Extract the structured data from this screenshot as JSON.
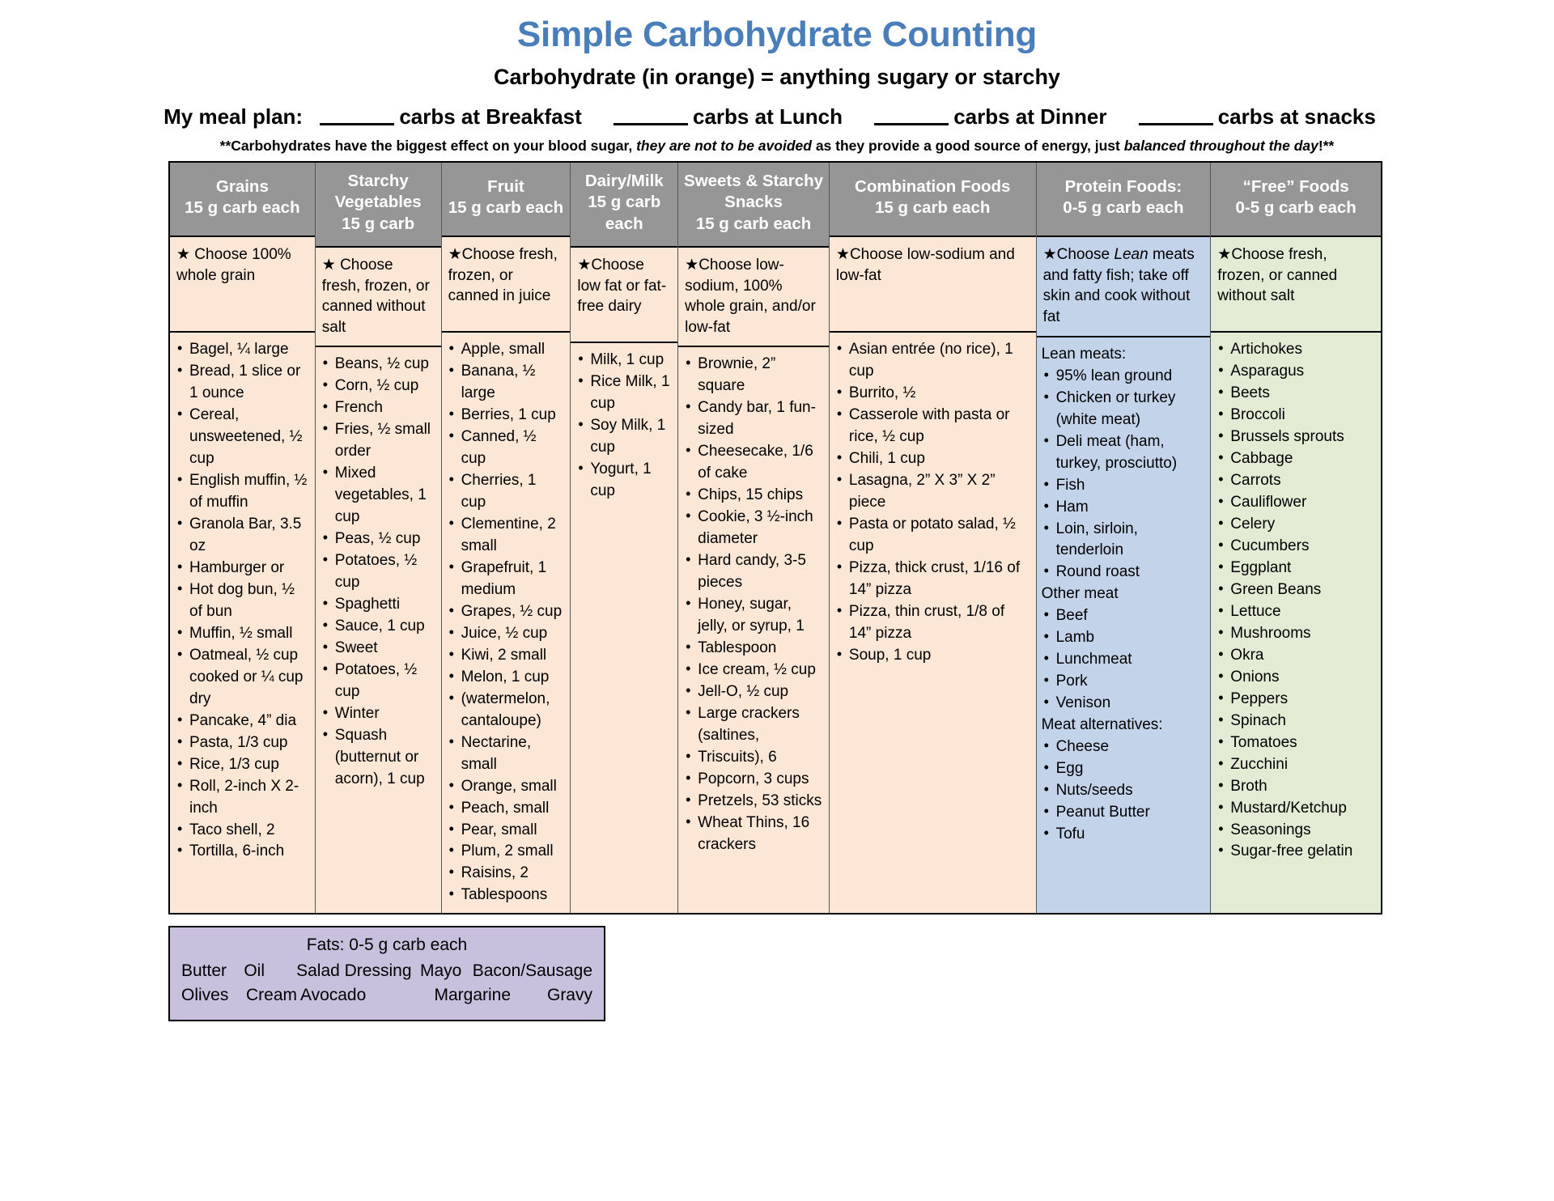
{
  "header": {
    "title": "Simple Carbohydrate Counting",
    "subtitle": "Carbohydrate (in orange) = anything sugary or starchy",
    "title_color": "#4a7ebb",
    "meal_plan": {
      "label": "My meal plan:",
      "seg1": "carbs at Breakfast",
      "seg2": "carbs at Lunch",
      "seg3": "carbs at Dinner",
      "seg4": "carbs at snacks"
    },
    "disclaimer": {
      "part1": "**Carbohydrates have the biggest effect on your blood sugar,",
      "em1": "they are not to be avoided",
      "part2": "as they provide a good source of energy, just",
      "em2": "balanced throughout the day",
      "part3": "!**"
    }
  },
  "colors": {
    "header_bg": "#969696",
    "carb_bg": "#fce6d5",
    "protein_bg": "#c3d4ea",
    "free_bg": "#e2ecd5",
    "fats_bg": "#c9c0dd"
  },
  "columns": [
    {
      "key": "grains",
      "title_line1": "Grains",
      "title_line2": "15 g carb each",
      "choose_pre": "★ Choose 100% whole grain",
      "items": [
        "Bagel, ¼ large",
        "Bread, 1 slice or 1 ounce",
        "Cereal, unsweetened, ½ cup",
        "English muffin, ½ of muffin",
        "Granola Bar, 3.5 oz",
        "Hamburger or",
        "Hot dog bun, ½ of bun",
        "Muffin, ½ small",
        "Oatmeal, ½ cup cooked or ¼ cup dry",
        "Pancake, 4” dia",
        "Pasta, 1/3 cup",
        "Rice, 1/3 cup",
        "Roll, 2-inch X 2-inch",
        "Taco shell, 2",
        "Tortilla, 6-inch"
      ]
    },
    {
      "key": "starchy_vegetables",
      "title_line1": "Starchy Vegetables",
      "title_line2": "15 g carb",
      "choose_pre": "★ Choose fresh, frozen, or canned without salt",
      "items": [
        "Beans, ½ cup",
        "Corn, ½ cup",
        "French",
        "Fries, ½ small order",
        "Mixed vegetables, 1 cup",
        "Peas, ½ cup",
        "Potatoes, ½ cup",
        "Spaghetti",
        "Sauce, 1 cup",
        "Sweet",
        "Potatoes, ½ cup",
        "Winter",
        "Squash (butternut or acorn), 1 cup"
      ]
    },
    {
      "key": "fruit",
      "title_line1": "Fruit",
      "title_line2": "15 g carb each",
      "choose_pre": "★Choose fresh, frozen, or canned in juice",
      "items": [
        "Apple, small",
        "Banana, ½ large",
        "Berries,  1 cup",
        "Canned, ½ cup",
        "Cherries, 1 cup",
        "Clementine, 2 small",
        "Grapefruit, 1 medium",
        "Grapes, ½ cup",
        "Juice, ½ cup",
        "Kiwi, 2 small",
        "Melon, 1 cup",
        "(watermelon, cantaloupe)",
        "Nectarine, small",
        "Orange, small",
        "Peach, small",
        "Pear, small",
        "Plum, 2 small",
        "Raisins, 2",
        "Tablespoons"
      ]
    },
    {
      "key": "dairy_milk",
      "title_line1": "Dairy/Milk",
      "title_line2": "15 g carb each",
      "choose_pre": "★Choose low fat or fat-free dairy",
      "items": [
        "Milk, 1 cup",
        "Rice Milk, 1 cup",
        "Soy Milk, 1 cup",
        "Yogurt, 1 cup"
      ]
    },
    {
      "key": "sweets_starchy_snacks",
      "title_line1": "Sweets & Starchy Snacks",
      "title_line2": "15 g carb each",
      "choose_pre": "★Choose low-sodium, 100% whole grain, and/or low-fat",
      "items": [
        "Brownie, 2” square",
        "Candy bar, 1 fun-sized",
        "Cheesecake, 1/6 of cake",
        "Chips, 15 chips",
        "Cookie, 3 ½-inch diameter",
        "Hard candy, 3-5 pieces",
        "Honey, sugar, jelly, or syrup, 1",
        "Tablespoon",
        "Ice cream, ½ cup",
        "Jell-O, ½ cup",
        "Large crackers (saltines,",
        "Triscuits), 6",
        "Popcorn, 3 cups",
        "Pretzels, 53 sticks",
        "Wheat Thins, 16 crackers"
      ]
    },
    {
      "key": "combination_foods",
      "title_line1": "Combination Foods",
      "title_line2": "15 g carb each",
      "choose_pre": "★Choose low-sodium and low-fat",
      "items": [
        "Asian entrée (no rice), 1 cup",
        "Burrito, ½",
        "Casserole with pasta or rice, ½ cup",
        "Chili, 1 cup",
        "Lasagna, 2” X 3” X 2” piece",
        "Pasta or potato salad, ½ cup",
        "Pizza, thick crust, 1/16 of 14” pizza",
        "Pizza, thin crust, 1/8 of 14” pizza",
        "Soup, 1 cup"
      ]
    },
    {
      "key": "protein_foods",
      "title_line1": "Protein Foods:",
      "title_line2": "0-5 g carb each",
      "choose_pre": "★Choose ",
      "choose_em": "Lean",
      "choose_post": " meats and fatty fish; take off skin and cook without fat",
      "groups": [
        {
          "label": "Lean meats:",
          "items": [
            "95% lean ground",
            "Chicken or turkey (white meat)",
            "Deli meat (ham, turkey, prosciutto)",
            "Fish",
            "Ham",
            "Loin, sirloin, tenderloin",
            "Round roast"
          ]
        },
        {
          "label": "Other meat",
          "items": [
            "Beef",
            "Lamb",
            "Lunchmeat",
            "Pork",
            "Venison"
          ]
        },
        {
          "label": "Meat alternatives:",
          "items": [
            "Cheese",
            "Egg",
            "Nuts/seeds",
            "Peanut Butter",
            "Tofu"
          ]
        }
      ]
    },
    {
      "key": "free_foods",
      "title_line1": "“Free” Foods",
      "title_line2": "0-5 g carb each",
      "choose_pre": "★Choose fresh, frozen, or canned without salt",
      "items": [
        "Artichokes",
        "Asparagus",
        "Beets",
        "Broccoli",
        "Brussels sprouts",
        "Cabbage",
        "Carrots",
        "Cauliflower",
        "Celery",
        "Cucumbers",
        "Eggplant",
        "Green Beans",
        "Lettuce",
        "Mushrooms",
        "Okra",
        "Onions",
        "Peppers",
        "Spinach",
        "Tomatoes",
        "Zucchini",
        "Broth",
        "Mustard/Ketchup",
        "Seasonings",
        "Sugar-free gelatin"
      ]
    }
  ],
  "fats": {
    "title": "Fats: 0-5 g carb each",
    "row1": [
      "Butter",
      "Oil",
      "Salad Dressing",
      "Mayo",
      "Bacon/Sausage"
    ],
    "row2": [
      "Olives",
      "Cream",
      "Avocado",
      "Margarine",
      "Gravy"
    ]
  }
}
